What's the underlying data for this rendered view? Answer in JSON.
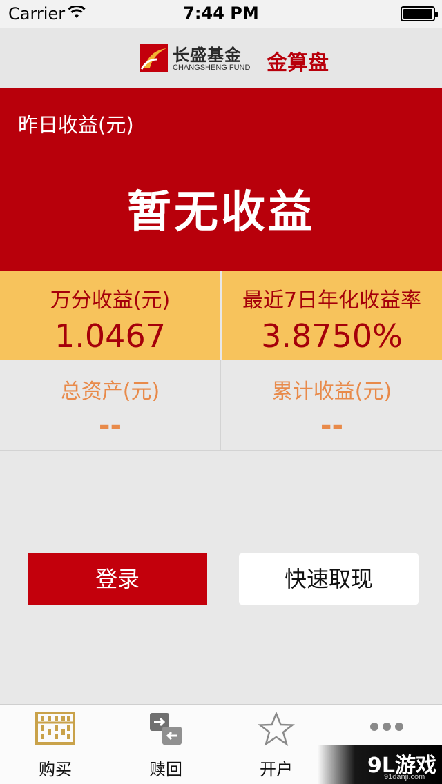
{
  "status_bar": {
    "carrier": "Carrier",
    "time": "7:44 PM",
    "wifi_icon": "wifi-icon",
    "battery_icon": "battery-icon"
  },
  "header": {
    "logo_cn": "长盛基金",
    "logo_en": "CHANGSHENG FUND",
    "brand": "金算盘"
  },
  "earnings": {
    "label": "昨日收益(元)",
    "value": "暂无收益"
  },
  "stats": [
    {
      "label": "万分收益(元)",
      "value": "1.0467"
    },
    {
      "label": "最近7日年化收益率",
      "value": "3.8750%"
    }
  ],
  "totals": [
    {
      "label": "总资产(元)",
      "value": "--"
    },
    {
      "label": "累计收益(元)",
      "value": "--"
    }
  ],
  "buttons": {
    "login": "登录",
    "withdraw": "快速取现"
  },
  "tabs": [
    {
      "label": "购买",
      "icon": "abacus-icon"
    },
    {
      "label": "赎回",
      "icon": "exchange-icon"
    },
    {
      "label": "开户",
      "icon": "star-icon"
    },
    {
      "label": "",
      "icon": "more-icon"
    }
  ],
  "watermark": {
    "main": "9L游戏",
    "sub": "91danji.com"
  },
  "colors": {
    "primary_red": "#b8000b",
    "button_red": "#c3000c",
    "stats_yellow": "#f7c35c",
    "stats_text": "#a5000a",
    "totals_text": "#e88a4a",
    "background": "#e8e8e8"
  }
}
